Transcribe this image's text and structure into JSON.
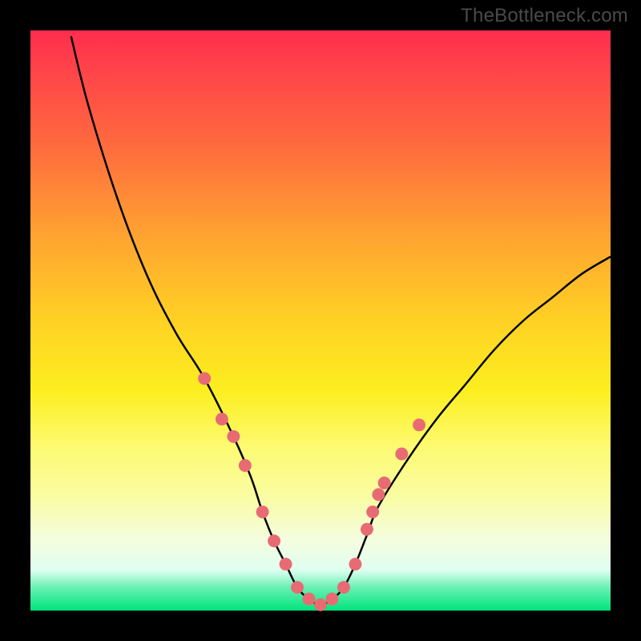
{
  "attribution": "TheBottleneck.com",
  "chart_data": {
    "type": "line",
    "title": "",
    "xlabel": "",
    "ylabel": "",
    "xlim": [
      0,
      100
    ],
    "ylim": [
      0,
      100
    ],
    "grid": false,
    "legend": false,
    "gradient_stops": [
      {
        "pos": 0.0,
        "color": "#ff2d4e"
      },
      {
        "pos": 0.5,
        "color": "#ffd124"
      },
      {
        "pos": 0.8,
        "color": "#fafca0"
      },
      {
        "pos": 0.96,
        "color": "#6af0b4"
      },
      {
        "pos": 1.0,
        "color": "#00e47b"
      }
    ],
    "series": [
      {
        "name": "bottleneck-curve",
        "color": "#000000",
        "x": [
          7,
          10,
          15,
          20,
          25,
          30,
          35,
          38,
          40,
          42,
          44,
          46,
          48,
          50,
          52,
          54,
          56,
          58,
          60,
          65,
          70,
          75,
          80,
          85,
          90,
          95,
          100
        ],
        "y": [
          99,
          87,
          71,
          58,
          48,
          40,
          30,
          23,
          17,
          12,
          8,
          4,
          2,
          1,
          2,
          4,
          8,
          13,
          18,
          26,
          33,
          39,
          45,
          50,
          54,
          58,
          61
        ]
      }
    ],
    "markers": {
      "color": "#e86b74",
      "radius_pct": 1.1,
      "points": [
        {
          "x": 30,
          "y": 40
        },
        {
          "x": 33,
          "y": 33
        },
        {
          "x": 35,
          "y": 30
        },
        {
          "x": 37,
          "y": 25
        },
        {
          "x": 40,
          "y": 17
        },
        {
          "x": 42,
          "y": 12
        },
        {
          "x": 44,
          "y": 8
        },
        {
          "x": 46,
          "y": 4
        },
        {
          "x": 48,
          "y": 2
        },
        {
          "x": 50,
          "y": 1
        },
        {
          "x": 52,
          "y": 2
        },
        {
          "x": 54,
          "y": 4
        },
        {
          "x": 56,
          "y": 8
        },
        {
          "x": 58,
          "y": 14
        },
        {
          "x": 59,
          "y": 17
        },
        {
          "x": 60,
          "y": 20
        },
        {
          "x": 61,
          "y": 22
        },
        {
          "x": 64,
          "y": 27
        },
        {
          "x": 67,
          "y": 32
        }
      ]
    }
  }
}
